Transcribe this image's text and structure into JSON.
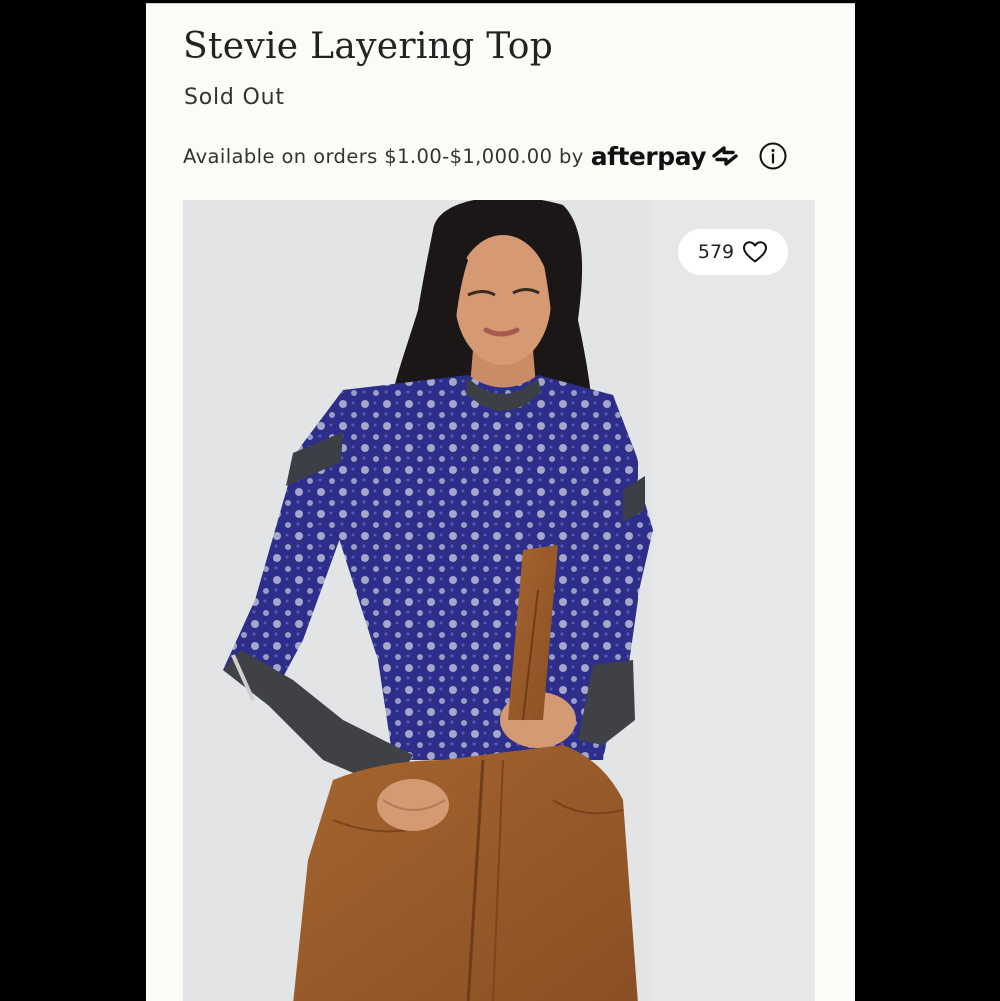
{
  "product": {
    "title": "Stevie Layering Top",
    "status": "Sold Out"
  },
  "afterpay": {
    "text": "Available on orders $1.00-$1,000.00 by",
    "brand": "afterpay",
    "brand_icon": "afterpay-arrows-icon",
    "info_icon": "info-icon"
  },
  "image": {
    "description_icon": "product-photo",
    "like_count": "579",
    "like_icon": "heart-outline-icon"
  },
  "colors": {
    "page_background": "#000000",
    "card_background": "#fdfbf8",
    "text": "#222222",
    "photo_background": "#e2e4e6",
    "sweater_blue": "#2e2f8c",
    "overalls_brown": "#9a5a2b"
  }
}
